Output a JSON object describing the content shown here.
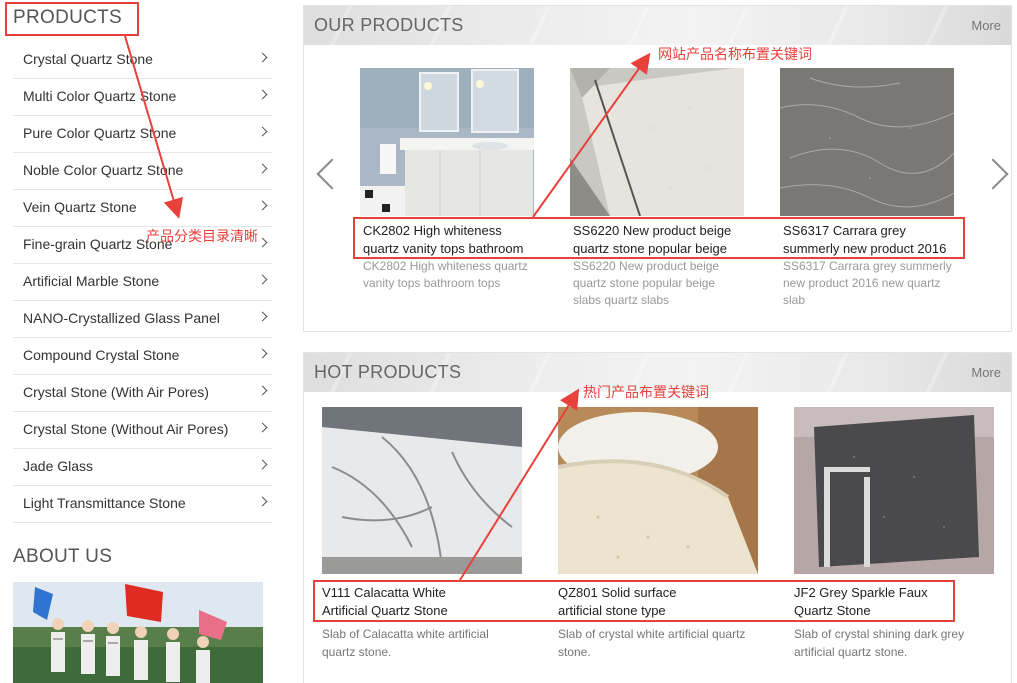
{
  "sidebar": {
    "products_title": "PRODUCTS",
    "categories": [
      "Crystal Quartz Stone",
      "Multi Color Quartz Stone",
      "Pure Color Quartz Stone",
      "Noble Color Quartz Stone",
      "Vein Quartz Stone",
      "Fine-grain Quartz Stone",
      "Artificial Marble Stone",
      "NANO-Crystallized Glass Panel",
      "Compound Crystal Stone",
      "Crystal Stone (With Air Pores)",
      "Crystal Stone (Without Air Pores)",
      "Jade Glass",
      "Light Transmittance Stone"
    ],
    "about_title": "ABOUT US"
  },
  "our_products": {
    "title": "OUR PRODUCTS",
    "more": "More",
    "items": [
      {
        "title_line1": "CK2802 High whiteness",
        "title_line2": "quartz vanity tops bathroom",
        "desc_line1": "CK2802 High whiteness quartz",
        "desc_line2": "vanity tops bathroom tops",
        "desc_line3": ""
      },
      {
        "title_line1": "SS6220 New product beige",
        "title_line2": "quartz stone popular beige",
        "desc_line1": "SS6220 New product beige",
        "desc_line2": "quartz stone popular beige",
        "desc_line3": "slabs quartz slabs"
      },
      {
        "title_line1": "SS6317 Carrara grey",
        "title_line2": "summerly new product 2016",
        "desc_line1": "SS6317 Carrara grey summerly",
        "desc_line2": "new product 2016 new quartz",
        "desc_line3": "slab"
      }
    ]
  },
  "hot_products": {
    "title": "HOT PRODUCTS",
    "more": "More",
    "items": [
      {
        "title_line1": "V111 Calacatta White",
        "title_line2": "Artificial Quartz Stone",
        "desc_line1": "Slab of Calacatta white artificial",
        "desc_line2": "quartz stone."
      },
      {
        "title_line1": "QZ801 Solid surface",
        "title_line2": "artificial stone type",
        "desc_line1": "Slab of crystal white artificial quartz",
        "desc_line2": "stone."
      },
      {
        "title_line1": "JF2 Grey Sparkle Faux",
        "title_line2": "Quartz Stone",
        "desc_line1": "Slab of crystal shining dark grey",
        "desc_line2": "artificial quartz stone."
      }
    ]
  },
  "annotations": {
    "category_note": "产品分类目录清晰",
    "product_name_note": "网站产品名称布置关键词",
    "hot_note": "热门产品布置关键词"
  },
  "colors": {
    "annotation_red": "#e8403a"
  },
  "icons": [
    "chevron-right-icon",
    "carousel-prev-icon",
    "carousel-next-icon"
  ]
}
